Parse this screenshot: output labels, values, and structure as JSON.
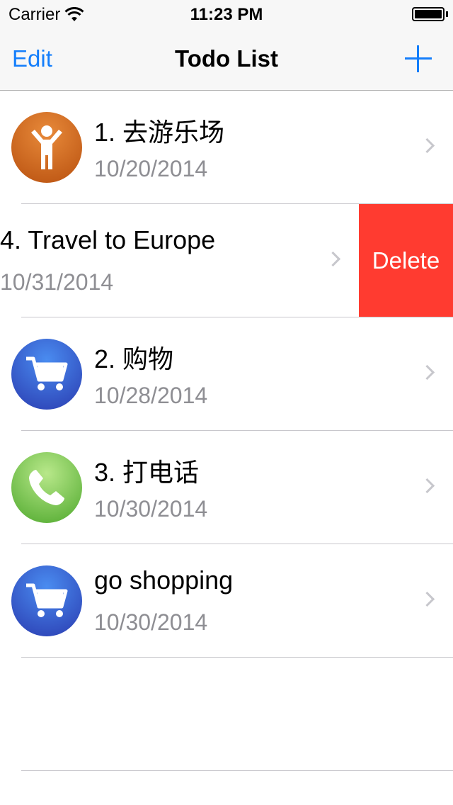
{
  "status_bar": {
    "carrier": "Carrier",
    "time": "11:23 PM"
  },
  "nav": {
    "edit_label": "Edit",
    "title": "Todo List",
    "add_icon": "plus-icon"
  },
  "colors": {
    "tint": "#147efb",
    "delete": "#ff3b30",
    "secondary_text": "#8e8e93"
  },
  "rows": [
    {
      "title": "1. 去游乐场",
      "date": "10/20/2014",
      "icon": "child-icon",
      "swiped": false
    },
    {
      "title": "4. Travel to Europe",
      "date": "10/31/2014",
      "icon": "",
      "swiped": true,
      "delete_label": "Delete"
    },
    {
      "title": "2. 购物",
      "date": "10/28/2014",
      "icon": "shopping-cart-icon",
      "swiped": false
    },
    {
      "title": "3. 打电话",
      "date": "10/30/2014",
      "icon": "phone-icon",
      "swiped": false
    },
    {
      "title": "go shopping",
      "date": "10/30/2014",
      "icon": "shopping-cart-icon",
      "swiped": false
    }
  ]
}
